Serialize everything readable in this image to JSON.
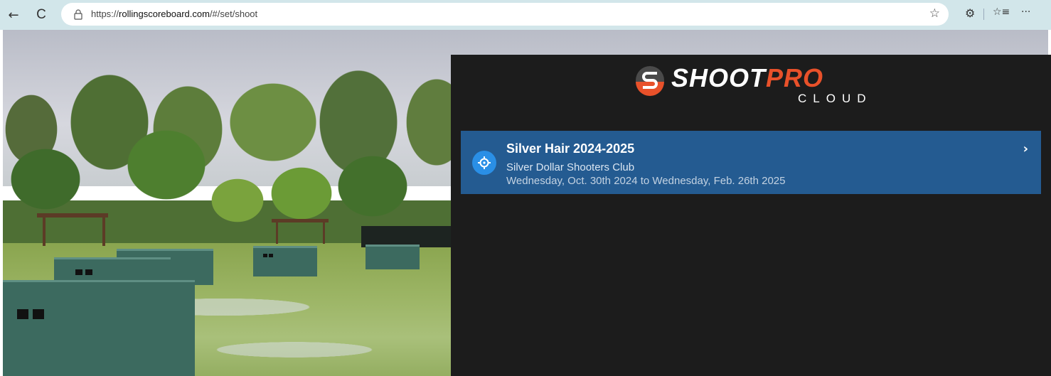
{
  "browser": {
    "url_prefix": "https://",
    "url_host": "rollingscoreboard.com",
    "url_path": "/#/set/shoot",
    "back_icon": "←",
    "reload_icon": "C",
    "favorite_icon": "☆",
    "extensions_icon": "⚙",
    "favorites_list_icon": "☆≡",
    "more_icon": "···"
  },
  "logo": {
    "shoot": "SHOOT",
    "pro": "PRO",
    "cloud": "CLOUD"
  },
  "shoots": [
    {
      "title": "Silver Hair 2024-2025",
      "club": "Silver Dollar Shooters Club",
      "dates": "Wednesday, Oct. 30th 2024 to Wednesday, Feb. 26th 2025",
      "chevron": "›"
    }
  ],
  "colors": {
    "panel_bg": "#1c1c1c",
    "card_bg": "#245b91",
    "accent_orange": "#e8512a",
    "icon_blue": "#2a8fe6"
  }
}
